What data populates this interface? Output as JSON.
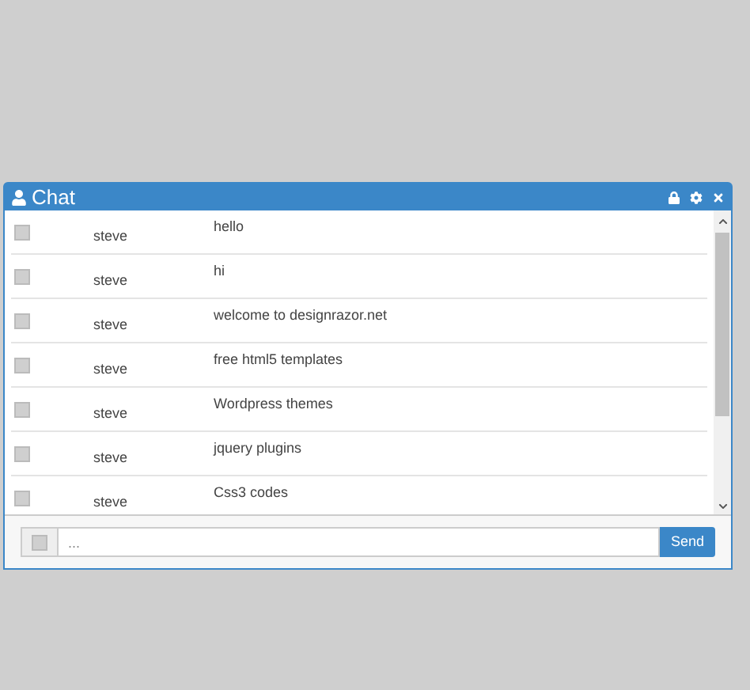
{
  "window": {
    "title": "Chat"
  },
  "messages": [
    {
      "user": "steve",
      "text": "hello"
    },
    {
      "user": "steve",
      "text": "hi"
    },
    {
      "user": "steve",
      "text": "welcome to designrazor.net"
    },
    {
      "user": "steve",
      "text": "free html5 templates"
    },
    {
      "user": "steve",
      "text": "Wordpress themes"
    },
    {
      "user": "steve",
      "text": "jquery plugins"
    },
    {
      "user": "steve",
      "text": "Css3 codes"
    }
  ],
  "composer": {
    "placeholder": "...",
    "button": "Send"
  }
}
